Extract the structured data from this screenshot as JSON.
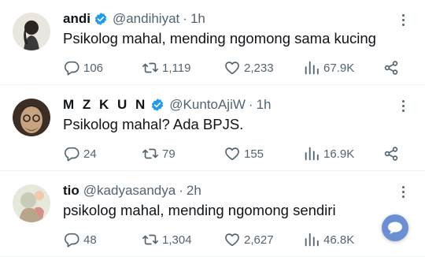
{
  "tweets": [
    {
      "name": "andi",
      "handle": "@andihiyat",
      "dot": "·",
      "time": "1h",
      "text": "Psikolog mahal, mending ngomong sama kucing",
      "replies": "106",
      "retweets": "1,119",
      "likes": "2,233",
      "views": "67.9K"
    },
    {
      "name": "M Z K U N",
      "handle": "@KuntoAjiW",
      "dot": "·",
      "time": "1h",
      "text": "Psikolog mahal? Ada BPJS.",
      "replies": "24",
      "retweets": "79",
      "likes": "155",
      "views": "16.9K"
    },
    {
      "name": "tio",
      "handle": "@kadyasandya",
      "dot": "·",
      "time": "2h",
      "text": "psikolog mahal, mending ngomong sendiri",
      "replies": "48",
      "retweets": "1,304",
      "likes": "2,627",
      "views": "46.8K"
    }
  ],
  "colors": {
    "verified": "#1d9bf0",
    "muted": "#536471",
    "text": "#0f1419",
    "divider": "#eff3f4"
  },
  "icons": [
    "verified-badge-icon",
    "more-icon",
    "reply-icon",
    "retweet-icon",
    "like-icon",
    "views-icon",
    "share-icon"
  ]
}
